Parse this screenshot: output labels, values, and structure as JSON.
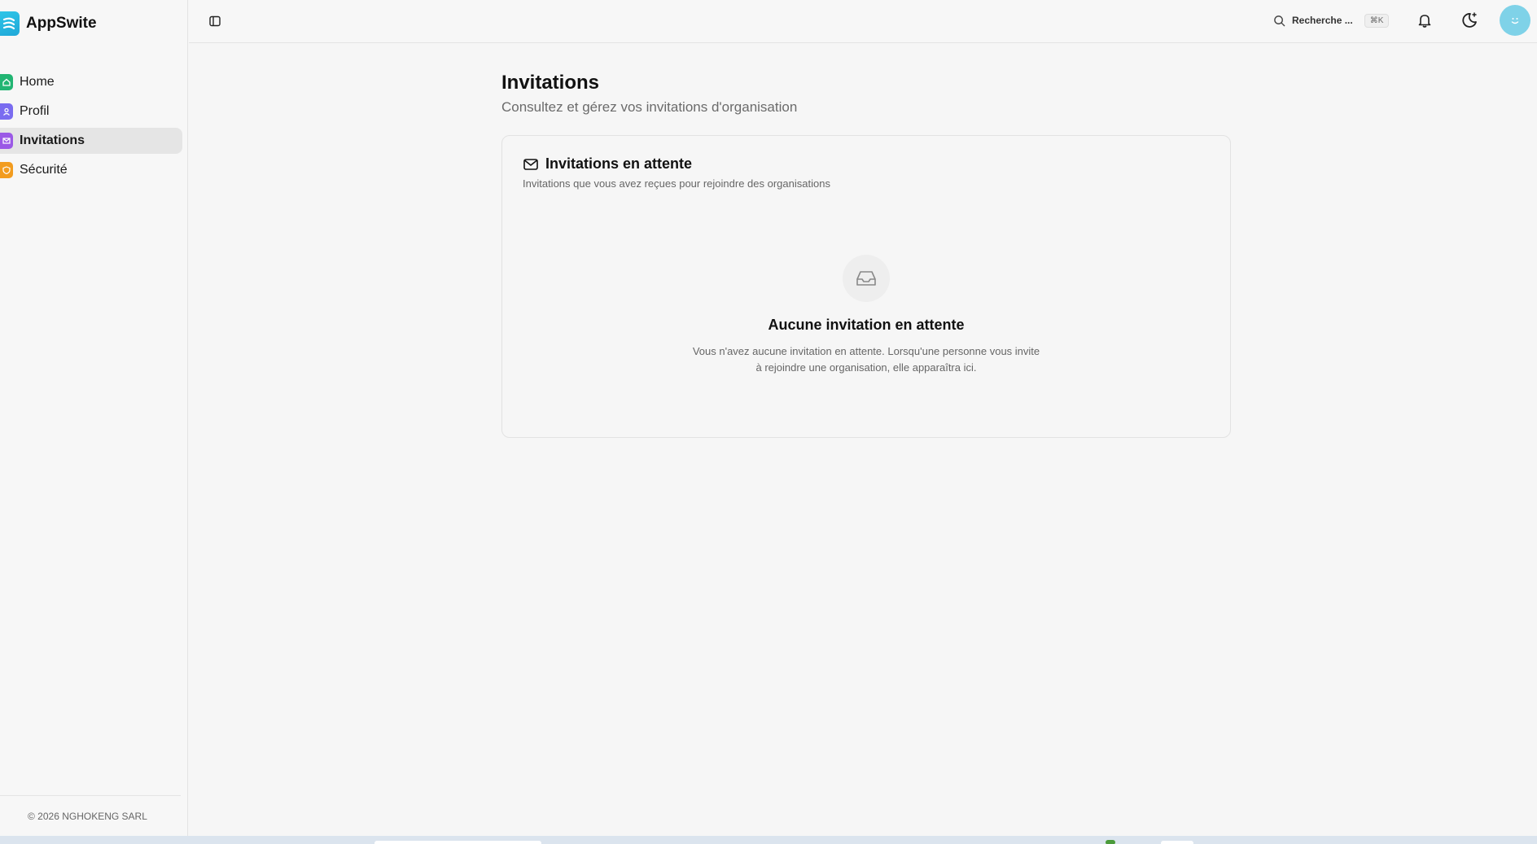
{
  "sidebar": {
    "brand": "AppSwite",
    "items": [
      {
        "label": "Home",
        "icon": "home-icon",
        "color": "#22b573"
      },
      {
        "label": "Profil",
        "icon": "user-icon",
        "color": "#7a6cf0"
      },
      {
        "label": "Invitations",
        "icon": "mail-icon",
        "color": "#9b59e6",
        "active": true
      },
      {
        "label": "Sécurité",
        "icon": "shield-icon",
        "color": "#f29c1f"
      }
    ],
    "footer": "© 2026 NGHOKENG SARL"
  },
  "topbar": {
    "search_label": "Recherche ...",
    "search_shortcut": "⌘K"
  },
  "page": {
    "title": "Invitations",
    "subtitle": "Consultez et gérez vos invitations d'organisation"
  },
  "card": {
    "title": "Invitations en attente",
    "description": "Invitations que vous avez reçues pour rejoindre des organisations",
    "empty_title": "Aucune invitation en attente",
    "empty_text": "Vous n'avez aucune invitation en attente. Lorsqu'une personne vous invite à rejoindre une organisation, elle apparaîtra ici."
  }
}
